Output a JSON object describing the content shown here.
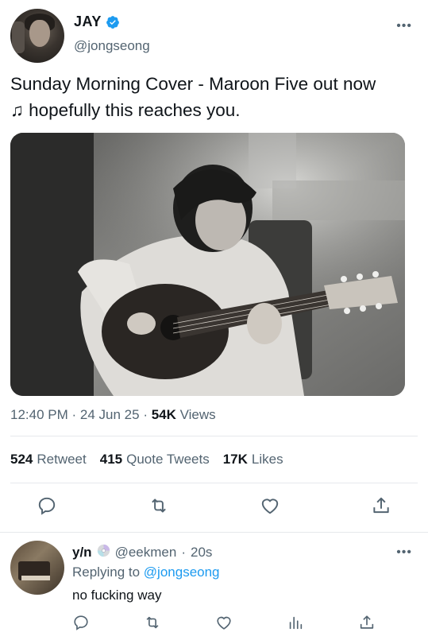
{
  "tweet": {
    "display_name": "JAY",
    "verified": true,
    "handle": "@jongseong",
    "more_icon": "ellipsis-icon",
    "text_line1": "Sunday Morning Cover - Maroon Five out now",
    "text_note": "♫",
    "text_line2": "hopefully this reaches you.",
    "media_description_icon": "photo",
    "time": "12:40 PM",
    "date": "24 Jun 25",
    "views_count": "54K",
    "views_label": "Views",
    "retweets_count": "524",
    "retweets_label": "Retweet",
    "quotes_count": "415",
    "quotes_label": "Quote Tweets",
    "likes_count": "17K",
    "likes_label": "Likes",
    "actions": [
      "reply-icon",
      "retweet-icon",
      "like-icon",
      "share-icon"
    ]
  },
  "reply": {
    "display_name": "y/n",
    "badge_icon": "cd-icon",
    "handle": "@eekmen",
    "separator": "·",
    "time": "20s",
    "replying_prefix": "Replying to",
    "replying_to": "@jongseong",
    "text": "no fucking way",
    "actions": [
      "reply-icon",
      "retweet-icon",
      "like-icon",
      "analytics-icon",
      "share-icon"
    ]
  },
  "colors": {
    "text": "#0f1419",
    "muted": "#536471",
    "link": "#1d9bf0",
    "verified": "#1d9bf0",
    "divider": "#e6e9ec"
  }
}
